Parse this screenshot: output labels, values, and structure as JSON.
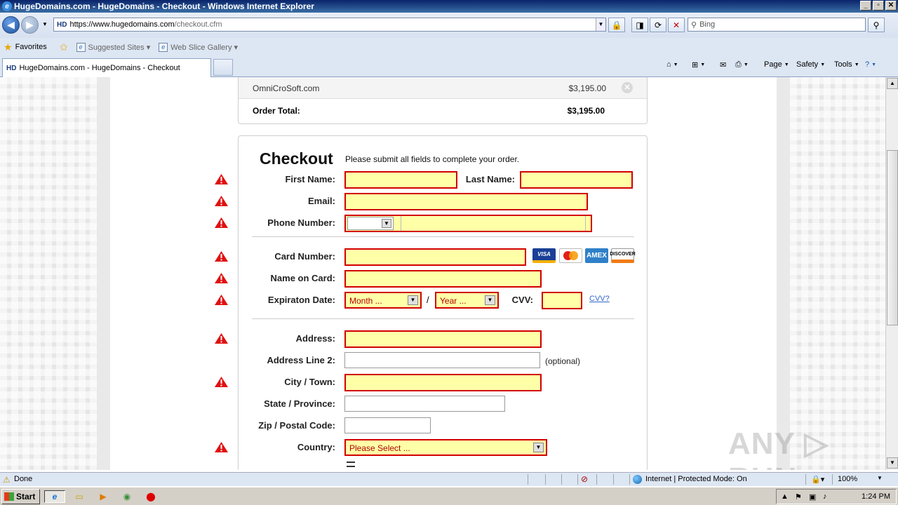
{
  "window": {
    "title": "HugeDomains.com - HugeDomains - Checkout - Windows Internet Explorer",
    "controls": [
      "_",
      "▫",
      "✕"
    ]
  },
  "nav": {
    "url_prefix": "https://www.hugedomains.com",
    "url_path": "/checkout.cfm",
    "site_badge": "HD",
    "search_placeholder": "Bing"
  },
  "favorites": {
    "favorites_label": "Favorites",
    "items": [
      "Suggested Sites ▾",
      "Web Slice Gallery ▾"
    ]
  },
  "tabs": {
    "active_tab": "HugeDomains.com - HugeDomains - Checkout",
    "commands": [
      "Page",
      "Safety",
      "Tools"
    ]
  },
  "order": {
    "domain": "OmniCroSoft.com",
    "price": "$3,195.00",
    "total_label": "Order Total:",
    "total_value": "$3,195.00"
  },
  "checkout": {
    "title": "Checkout",
    "subtitle": "Please submit all fields to complete your order.",
    "labels": {
      "first_name": "First Name:",
      "last_name": "Last Name:",
      "email": "Email:",
      "phone": "Phone Number:",
      "card_number": "Card Number:",
      "name_on_card": "Name on Card:",
      "expiration": "Expiraton Date:",
      "cvv": "CVV:",
      "address": "Address:",
      "address2": "Address Line 2:",
      "city": "City / Town:",
      "state": "State / Province:",
      "zip": "Zip / Postal Code:",
      "country": "Country:"
    },
    "month_select": "Month ...",
    "year_select": "Year ...",
    "date_separator": "/",
    "cvv_link": "CVV?",
    "optional_note": "(optional)",
    "country_select": "Please Select ...",
    "cards": [
      "VISA",
      "MasterCard",
      "AMEX",
      "DISCOVER"
    ]
  },
  "watermark": "ANY ▷ RUN",
  "status": {
    "text": "Done",
    "zone": "Internet | Protected Mode: On",
    "zoom": "100%"
  },
  "taskbar": {
    "start": "Start",
    "clock": "1:24 PM"
  },
  "colors": {
    "error_border": "#d10000",
    "error_fill": "#ffffa8",
    "link": "#3366cc"
  }
}
